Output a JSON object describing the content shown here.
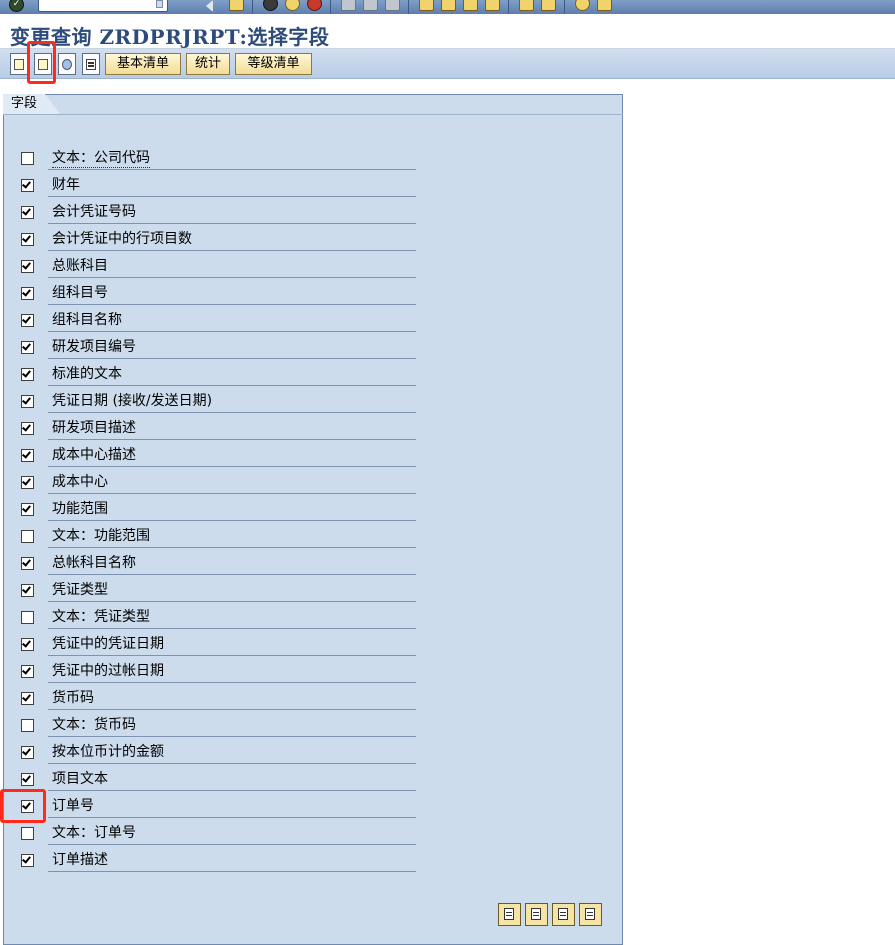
{
  "window": {
    "title": "变更查询 ZRDPRJRPT:选择字段"
  },
  "app_toolbar": {
    "buttons": [
      "基本清单",
      "统计",
      "等级清单"
    ]
  },
  "panel": {
    "tab_label": "字段",
    "fields": [
      {
        "label": "文本：公司代码",
        "checked": false
      },
      {
        "label": "财年",
        "checked": true
      },
      {
        "label": "会计凭证号码",
        "checked": true
      },
      {
        "label": "会计凭证中的行项目数",
        "checked": true
      },
      {
        "label": "总账科目",
        "checked": true
      },
      {
        "label": "组科目号",
        "checked": true
      },
      {
        "label": "组科目名称",
        "checked": true
      },
      {
        "label": "研发项目编号",
        "checked": true
      },
      {
        "label": "标准的文本",
        "checked": true
      },
      {
        "label": "凭证日期 (接收/发送日期)",
        "checked": true
      },
      {
        "label": "研发项目描述",
        "checked": true
      },
      {
        "label": "成本中心描述",
        "checked": true
      },
      {
        "label": "成本中心",
        "checked": true
      },
      {
        "label": "功能范围",
        "checked": true
      },
      {
        "label": "文本：功能范围",
        "checked": false
      },
      {
        "label": "总帐科目名称",
        "checked": true
      },
      {
        "label": "凭证类型",
        "checked": true
      },
      {
        "label": "文本：凭证类型",
        "checked": false
      },
      {
        "label": "凭证中的凭证日期",
        "checked": true
      },
      {
        "label": "凭证中的过帐日期",
        "checked": true
      },
      {
        "label": "货币码",
        "checked": true
      },
      {
        "label": "文本：货币码",
        "checked": false
      },
      {
        "label": "按本位币计的金额",
        "checked": true
      },
      {
        "label": "项目文本",
        "checked": true
      },
      {
        "label": "订单号",
        "checked": true
      },
      {
        "label": "文本：订单号",
        "checked": false
      },
      {
        "label": "订单描述",
        "checked": true
      }
    ]
  },
  "colors": {
    "title": "#2c4a7a",
    "panel_bg": "#ccdcec",
    "highlight": "#ff2a1a"
  }
}
